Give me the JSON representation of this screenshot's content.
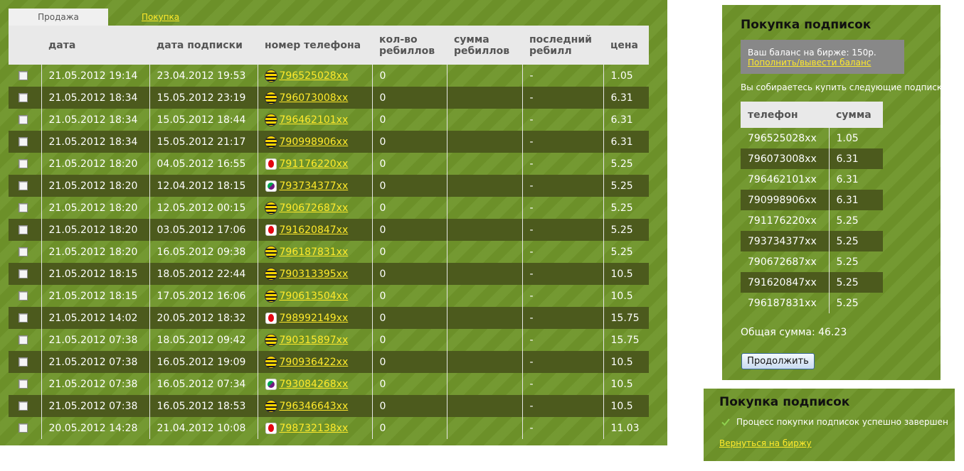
{
  "tabs": {
    "sell": "Продажа",
    "buy": "Покупка"
  },
  "table": {
    "headers": [
      "",
      "дата",
      "дата подписки",
      "номер телефона",
      "кол-во ребиллов",
      "сумма ребиллов",
      "последний ребилл",
      "цена"
    ],
    "rows": [
      {
        "date": "21.05.2012 19:14",
        "sub_date": "23.04.2012 19:53",
        "operator": "beeline",
        "phone": "796525028xx",
        "rebills": "0",
        "rebill_sum": "",
        "last_rebill": "-",
        "price": "1.05"
      },
      {
        "date": "21.05.2012 18:34",
        "sub_date": "15.05.2012 23:19",
        "operator": "beeline",
        "phone": "796073008xx",
        "rebills": "0",
        "rebill_sum": "",
        "last_rebill": "-",
        "price": "6.31"
      },
      {
        "date": "21.05.2012 18:34",
        "sub_date": "15.05.2012 18:44",
        "operator": "beeline",
        "phone": "796462101xx",
        "rebills": "0",
        "rebill_sum": "",
        "last_rebill": "-",
        "price": "6.31"
      },
      {
        "date": "21.05.2012 18:34",
        "sub_date": "15.05.2012 21:17",
        "operator": "beeline",
        "phone": "790998906xx",
        "rebills": "0",
        "rebill_sum": "",
        "last_rebill": "-",
        "price": "6.31"
      },
      {
        "date": "21.05.2012 18:20",
        "sub_date": "04.05.2012 16:55",
        "operator": "mts",
        "phone": "791176220xx",
        "rebills": "0",
        "rebill_sum": "",
        "last_rebill": "-",
        "price": "5.25"
      },
      {
        "date": "21.05.2012 18:20",
        "sub_date": "12.04.2012 18:15",
        "operator": "megafon",
        "phone": "793734377xx",
        "rebills": "0",
        "rebill_sum": "",
        "last_rebill": "-",
        "price": "5.25"
      },
      {
        "date": "21.05.2012 18:20",
        "sub_date": "12.05.2012 00:15",
        "operator": "beeline",
        "phone": "790672687xx",
        "rebills": "0",
        "rebill_sum": "",
        "last_rebill": "-",
        "price": "5.25"
      },
      {
        "date": "21.05.2012 18:20",
        "sub_date": "03.05.2012 17:06",
        "operator": "mts",
        "phone": "791620847xx",
        "rebills": "0",
        "rebill_sum": "",
        "last_rebill": "-",
        "price": "5.25"
      },
      {
        "date": "21.05.2012 18:20",
        "sub_date": "16.05.2012 09:38",
        "operator": "beeline",
        "phone": "796187831xx",
        "rebills": "0",
        "rebill_sum": "",
        "last_rebill": "-",
        "price": "5.25"
      },
      {
        "date": "21.05.2012 18:15",
        "sub_date": "18.05.2012 22:44",
        "operator": "beeline",
        "phone": "790313395xx",
        "rebills": "0",
        "rebill_sum": "",
        "last_rebill": "-",
        "price": "10.5"
      },
      {
        "date": "21.05.2012 18:15",
        "sub_date": "17.05.2012 16:06",
        "operator": "beeline",
        "phone": "790613504xx",
        "rebills": "0",
        "rebill_sum": "",
        "last_rebill": "-",
        "price": "10.5"
      },
      {
        "date": "21.05.2012 14:02",
        "sub_date": "20.05.2012 18:32",
        "operator": "mts",
        "phone": "798992149xx",
        "rebills": "0",
        "rebill_sum": "",
        "last_rebill": "-",
        "price": "15.75"
      },
      {
        "date": "21.05.2012 07:38",
        "sub_date": "18.05.2012 09:42",
        "operator": "beeline",
        "phone": "790315897xx",
        "rebills": "0",
        "rebill_sum": "",
        "last_rebill": "-",
        "price": "15.75"
      },
      {
        "date": "21.05.2012 07:38",
        "sub_date": "16.05.2012 19:09",
        "operator": "beeline",
        "phone": "790936422xx",
        "rebills": "0",
        "rebill_sum": "",
        "last_rebill": "-",
        "price": "10.5"
      },
      {
        "date": "21.05.2012 07:38",
        "sub_date": "16.05.2012 07:34",
        "operator": "megafon",
        "phone": "793084268xx",
        "rebills": "0",
        "rebill_sum": "",
        "last_rebill": "-",
        "price": "10.5"
      },
      {
        "date": "21.05.2012 07:38",
        "sub_date": "16.05.2012 18:53",
        "operator": "beeline",
        "phone": "796346643xx",
        "rebills": "0",
        "rebill_sum": "",
        "last_rebill": "-",
        "price": "10.5"
      },
      {
        "date": "20.05.2012 14:28",
        "sub_date": "21.04.2012 10:08",
        "operator": "mts",
        "phone": "798732138xx",
        "rebills": "0",
        "rebill_sum": "",
        "last_rebill": "-",
        "price": "11.03"
      }
    ]
  },
  "purchase_panel": {
    "title": "Покупка подписок",
    "balance_text": "Ваш баланс на бирже: 150р.",
    "balance_link": "Пополнить/вывести баланс",
    "intro": "Вы собираетесь купить следующие подписки:",
    "headers": [
      "телефон",
      "сумма"
    ],
    "items": [
      {
        "phone": "796525028xx",
        "sum": "1.05"
      },
      {
        "phone": "796073008xx",
        "sum": "6.31"
      },
      {
        "phone": "796462101xx",
        "sum": "6.31"
      },
      {
        "phone": "790998906xx",
        "sum": "6.31"
      },
      {
        "phone": "791176220xx",
        "sum": "5.25"
      },
      {
        "phone": "793734377xx",
        "sum": "5.25"
      },
      {
        "phone": "790672687xx",
        "sum": "5.25"
      },
      {
        "phone": "791620847xx",
        "sum": "5.25"
      },
      {
        "phone": "796187831xx",
        "sum": "5.25"
      }
    ],
    "total": "Общая сумма: 46.23",
    "continue_label": "Продолжить"
  },
  "success_panel": {
    "title": "Покупка подписок",
    "message": "Процесс покупки подписок успешно завершен",
    "back_link": "Вернуться на биржу"
  },
  "colors": {
    "background_green": "#6f952a",
    "row_dark": "#4c5a1d",
    "link_yellow": "#ffea2b",
    "header_grey": "#e9e9e9"
  }
}
